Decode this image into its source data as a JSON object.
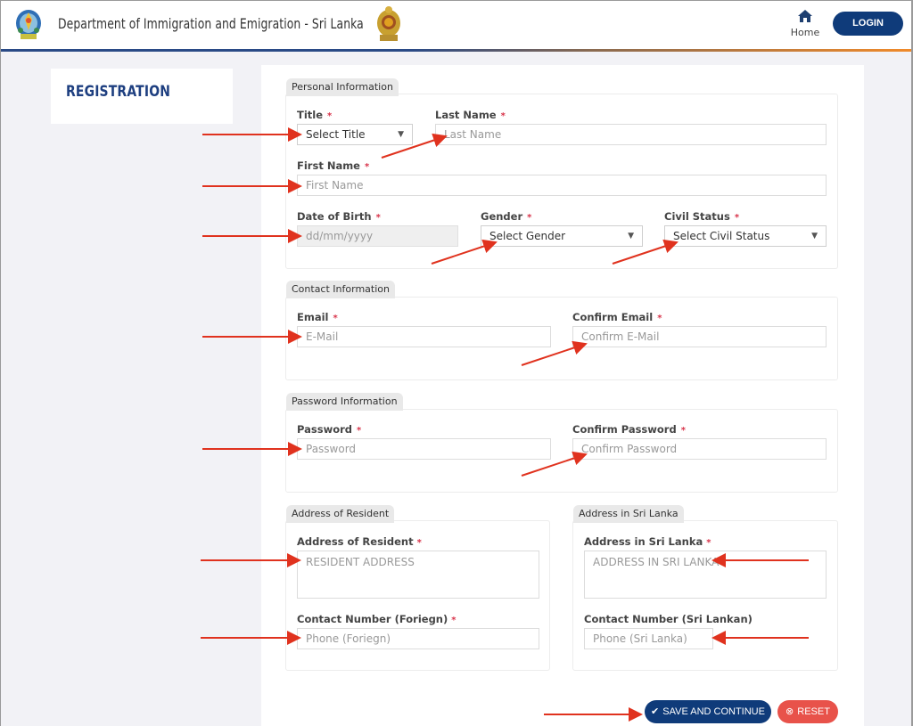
{
  "header": {
    "title": "Department of Immigration and Emigration - Sri Lanka",
    "home_label": "Home",
    "login_label": "LOGIN",
    "accent_color": "#0f3b7a"
  },
  "sidebar": {
    "title": "REGISTRATION"
  },
  "sections": {
    "personal": {
      "legend": "Personal Information",
      "title_label": "Title",
      "title_value": "Select Title",
      "last_name_label": "Last Name",
      "last_name_placeholder": "Last Name",
      "first_name_label": "First Name",
      "first_name_placeholder": "First Name",
      "dob_label": "Date of Birth",
      "dob_placeholder": "dd/mm/yyyy",
      "gender_label": "Gender",
      "gender_value": "Select Gender",
      "civil_label": "Civil Status",
      "civil_value": "Select Civil Status"
    },
    "contact": {
      "legend": "Contact Information",
      "email_label": "Email",
      "email_placeholder": "E-Mail",
      "confirm_email_label": "Confirm Email",
      "confirm_email_placeholder": "Confirm E-Mail"
    },
    "password": {
      "legend": "Password Information",
      "password_label": "Password",
      "password_placeholder": "Password",
      "confirm_password_label": "Confirm Password",
      "confirm_password_placeholder": "Confirm Password"
    },
    "resident": {
      "legend": "Address of Resident",
      "address_label": "Address of Resident",
      "address_placeholder": "RESIDENT ADDRESS",
      "phone_label": "Contact Number (Foriegn)",
      "phone_placeholder": "Phone (Foriegn)"
    },
    "srilanka": {
      "legend": "Address in Sri Lanka",
      "address_label": "Address in Sri Lanka",
      "address_placeholder": "ADDRESS IN SRI LANKA",
      "phone_label": "Contact Number (Sri Lankan)",
      "phone_placeholder": "Phone (Sri Lanka)"
    }
  },
  "required_marker": "*",
  "dropdown_caret": "▼",
  "actions": {
    "save_label": "SAVE AND CONTINUE",
    "reset_label": "RESET",
    "save_icon": "✔",
    "reset_icon": "⊗",
    "reset_color": "#e8524a"
  },
  "annotation_color": "#e0321e"
}
